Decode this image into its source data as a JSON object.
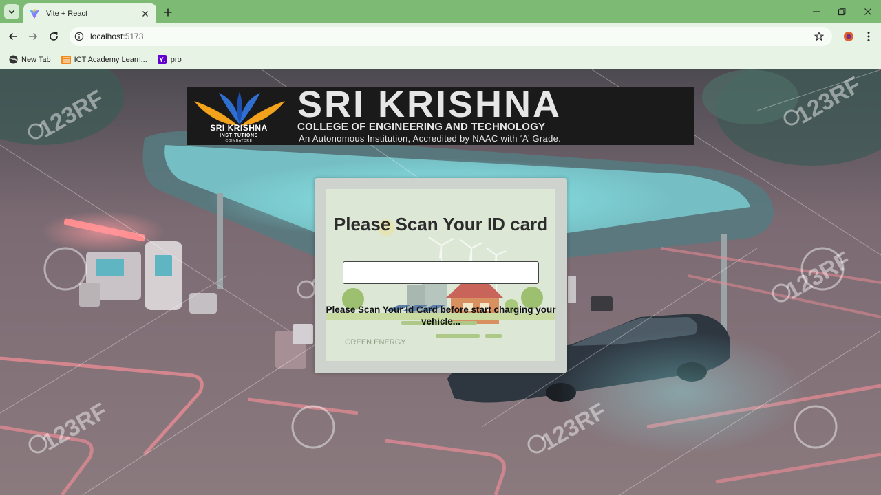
{
  "browser": {
    "tab": {
      "title": "Vite + React",
      "favicon": "vite-logo-icon"
    },
    "address": {
      "host": "localhost",
      "port": ":5173"
    },
    "bookmarks": [
      {
        "label": "New Tab",
        "icon": "globe-icon"
      },
      {
        "label": "ICT Academy Learn...",
        "icon": "ict-academy-icon"
      },
      {
        "label": "pro",
        "icon": "yahoo-icon"
      }
    ]
  },
  "banner": {
    "title": "SRI KRISHNA",
    "subtitle": "COLLEGE OF ENGINEERING AND TECHNOLOGY",
    "tagline": "An Autonomous Institution, Accredited by NAAC with ‘A’ Grade.",
    "logo": {
      "name": "SRI KRISHNA",
      "line1": "INSTITUTIONS",
      "line2": "COIMBATORE"
    }
  },
  "scan_card": {
    "heading": "Please Scan Your ID card",
    "input_value": "",
    "message": "Please Scan Your Id Card before start charging your vehicle...",
    "art_label": "GREEN ENERGY"
  },
  "watermark": {
    "text": "123RF"
  },
  "colors": {
    "chrome": "#7dbb74",
    "toolbar": "#e7f3e4",
    "card": "#cfd3cd",
    "logo_blue": "#2f6fd1",
    "logo_orange": "#f3a21c"
  }
}
